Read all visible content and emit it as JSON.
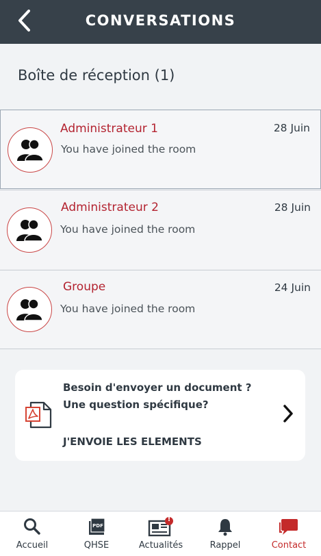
{
  "header": {
    "title": "CONVERSATIONS"
  },
  "inbox": {
    "title": "Boîte de réception (1)"
  },
  "conversations": [
    {
      "name": "Administrateur 1",
      "message": "You have joined the room",
      "date": "28 Juin"
    },
    {
      "name": "Administrateur 2",
      "message": "You have joined the room",
      "date": "28 Juin"
    },
    {
      "name": "Groupe",
      "message": "You have joined the room",
      "date": "24 Juin"
    }
  ],
  "card": {
    "line1": "Besoin d'envoyer un document ?",
    "line2": "Une question spécifique?",
    "cta": "J'ENVOIE LES ELEMENTS"
  },
  "tabs": [
    {
      "label": "Accueil",
      "icon": "search-icon"
    },
    {
      "label": "QHSE",
      "icon": "pdf-icon"
    },
    {
      "label": "Actualités",
      "icon": "newspaper-icon",
      "badge": "!"
    },
    {
      "label": "Rappel",
      "icon": "bell-icon"
    },
    {
      "label": "Contact",
      "icon": "chat-icon"
    }
  ],
  "colors": {
    "header": "#37414a",
    "accent": "#b32330",
    "background": "#f1f3f5"
  }
}
